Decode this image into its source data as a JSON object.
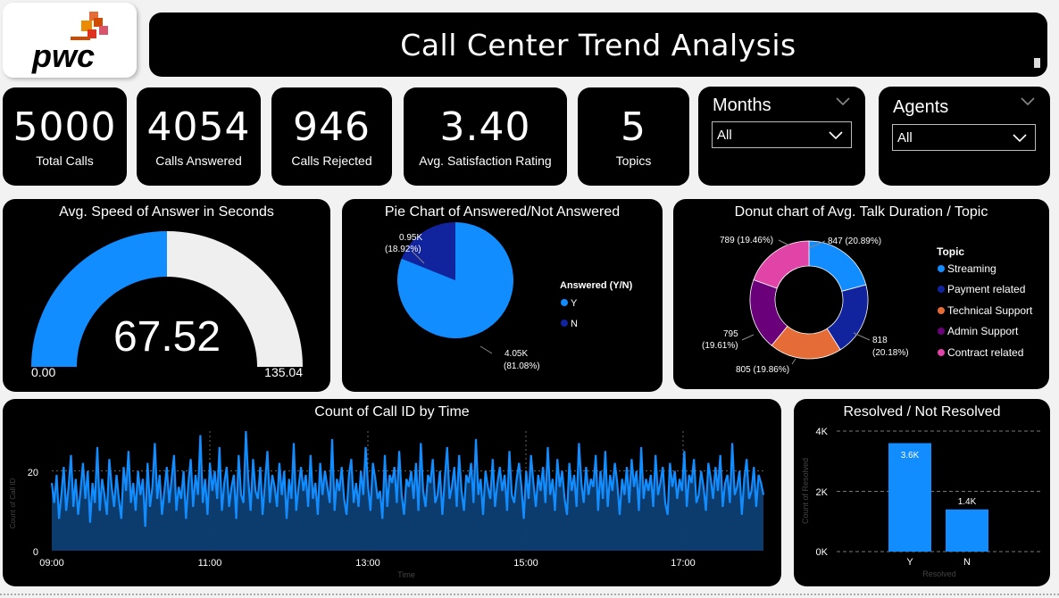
{
  "header": {
    "logo_text": "pwc",
    "title": "Call Center Trend Analysis"
  },
  "kpis": [
    {
      "value": "5000",
      "label": "Total Calls"
    },
    {
      "value": "4054",
      "label": "Calls Answered"
    },
    {
      "value": "946",
      "label": "Calls Rejected"
    },
    {
      "value": "3.40",
      "label": "Avg. Satisfaction Rating"
    },
    {
      "value": "5",
      "label": "Topics"
    }
  ],
  "slicers": {
    "months": {
      "title": "Months",
      "selected": "All"
    },
    "agents": {
      "title": "Agents",
      "selected": "All"
    }
  },
  "colors": {
    "card_bg": "#000000",
    "blue": "#118DFF",
    "navy": "#12239E",
    "orange": "#E66C37",
    "purple": "#6B007B",
    "pink": "#E044A7",
    "gauge_remaining": "#F0EFEF"
  },
  "chart_data": [
    {
      "type": "gauge",
      "title": "Avg. Speed of Answer in Seconds",
      "value": 67.52,
      "value_label": "67.52",
      "min": 0,
      "min_label": "0.00",
      "max": 135.04,
      "max_label": "135.04"
    },
    {
      "type": "pie",
      "title": "Pie Chart of Answered/Not Answered",
      "legend_title": "Answered (Y/N)",
      "legend_position": "right",
      "slices": [
        {
          "name": "Y",
          "value": 4054,
          "label": "4.05K",
          "pct": "(81.08%)"
        },
        {
          "name": "N",
          "value": 946,
          "label": "0.95K",
          "pct": "(18.92%)"
        }
      ]
    },
    {
      "type": "donut",
      "title": "Donut chart of Avg. Talk Duration / Topic",
      "legend_title": "Topic",
      "legend_position": "right",
      "slices": [
        {
          "name": "Streaming",
          "value": 847,
          "label": "847 (20.89%)"
        },
        {
          "name": "Payment related",
          "value": 818,
          "label_l1": "818",
          "label_l2": "(20.18%)"
        },
        {
          "name": "Technical Support",
          "value": 805,
          "label": "805 (19.86%)"
        },
        {
          "name": "Admin Support",
          "value": 795,
          "label_l1": "795",
          "label_l2": "(19.61%)"
        },
        {
          "name": "Contract related",
          "value": 789,
          "label": "789 (19.46%)"
        }
      ]
    },
    {
      "type": "area",
      "title": "Count of Call ID by Time",
      "xlabel": "Time",
      "ylabel": "Count of Call ID",
      "x_ticks": [
        "09:00",
        "11:00",
        "13:00",
        "15:00",
        "17:00"
      ],
      "y_ticks": [
        "0",
        "20"
      ],
      "ylim": [
        0,
        30
      ],
      "values": [
        17,
        12,
        19,
        8,
        14,
        21,
        10,
        16,
        24,
        11,
        18,
        9,
        15,
        22,
        13,
        20,
        7,
        17,
        12,
        26,
        10,
        18,
        14,
        9,
        23,
        16,
        11,
        19,
        13,
        8,
        21,
        15,
        25,
        12,
        17,
        10,
        20,
        14,
        18,
        6,
        22,
        11,
        16,
        27,
        13,
        19,
        9,
        15,
        21,
        12,
        18,
        24,
        10,
        16,
        13,
        20,
        8,
        17,
        23,
        11,
        19,
        14,
        29,
        12,
        18,
        9,
        22,
        15,
        20,
        13,
        26,
        10,
        17,
        21,
        11,
        16,
        19,
        8,
        24,
        14,
        12,
        30,
        18,
        10,
        23,
        15,
        13,
        21,
        9,
        17,
        25,
        12,
        19,
        16,
        11,
        22,
        14,
        20,
        8,
        18,
        13,
        27,
        10,
        16,
        21,
        15,
        19,
        11,
        24,
        13,
        17,
        9,
        22,
        14,
        20,
        16,
        12,
        28,
        10,
        18,
        15,
        21,
        13,
        9,
        19,
        23,
        12,
        17,
        11,
        20,
        14,
        26,
        16,
        10,
        22,
        18,
        13,
        15,
        8,
        24,
        11,
        19,
        17,
        21,
        12,
        25,
        14,
        9,
        18,
        16,
        20,
        13,
        22,
        10,
        27,
        15,
        11,
        19,
        17,
        23,
        12,
        14,
        20,
        9,
        18,
        26,
        13,
        16,
        21,
        11,
        24,
        15,
        10,
        19,
        17,
        22,
        12,
        28,
        14,
        18,
        9,
        20,
        16,
        13,
        23,
        11,
        17,
        21,
        15,
        19,
        10,
        25,
        14,
        12,
        18,
        22,
        16,
        8,
        20,
        13,
        24,
        17,
        11,
        19,
        15,
        21,
        12,
        26,
        14,
        18,
        10,
        23,
        16,
        20,
        13,
        9,
        22,
        15,
        19,
        11,
        27,
        17,
        12,
        21,
        14,
        18,
        16,
        24,
        10,
        20,
        13,
        25,
        11,
        19,
        15,
        22,
        17,
        9,
        18,
        14,
        21,
        12,
        23,
        16,
        20,
        10,
        26,
        13,
        18,
        15,
        19,
        11,
        24,
        14,
        17,
        21,
        12,
        9,
        22,
        16,
        20,
        13,
        18,
        15,
        25,
        11,
        19,
        17,
        23,
        12,
        14,
        20,
        16,
        10,
        22,
        18,
        13,
        21,
        15,
        24,
        11,
        17,
        19,
        12,
        27,
        14,
        16,
        20,
        9,
        18,
        23,
        13,
        15,
        21,
        11,
        19,
        17,
        14
      ]
    },
    {
      "type": "bar",
      "title": "Resolved / Not Resolved",
      "xlabel": "Resolved",
      "ylabel": "Count of Resolved",
      "categories": [
        "Y",
        "N"
      ],
      "values": [
        3600,
        1400
      ],
      "value_labels": [
        "3.6K",
        "1.4K"
      ],
      "y_ticks": [
        "0K",
        "2K",
        "4K"
      ],
      "ylim": [
        0,
        4000
      ]
    }
  ]
}
